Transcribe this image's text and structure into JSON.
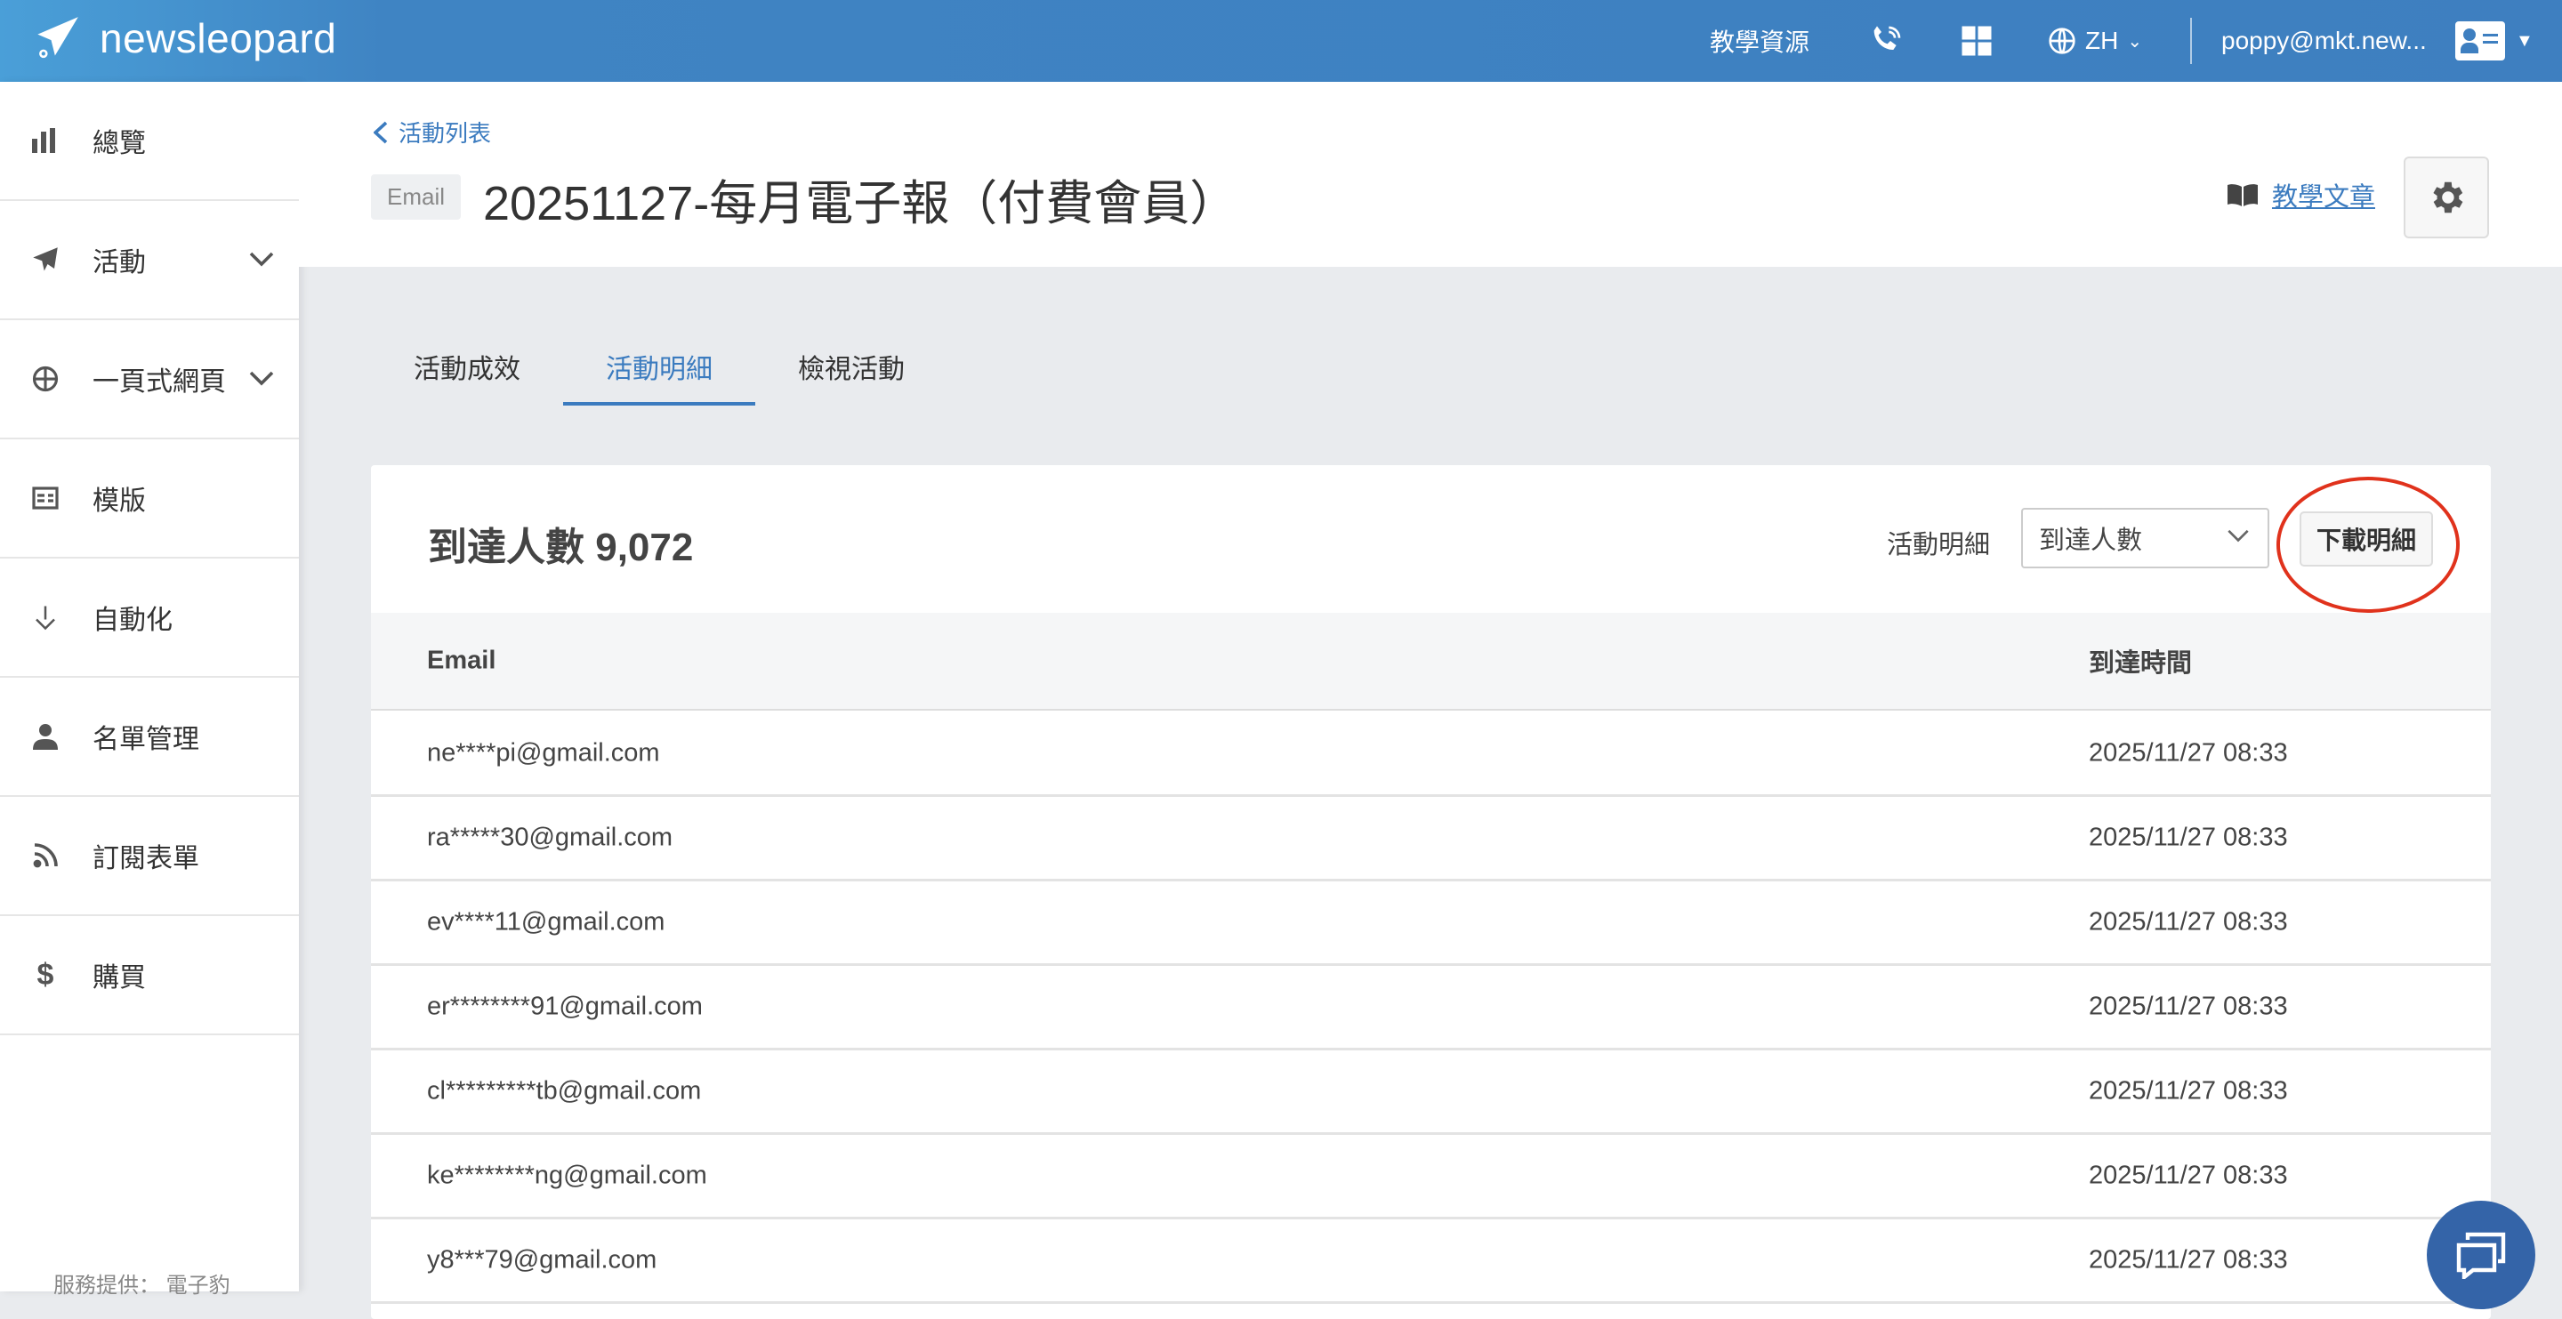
{
  "topbar": {
    "brand": "newsleopard",
    "resources": "教學資源",
    "language": "ZH",
    "account": "poppy@mkt.new..."
  },
  "sidebar": {
    "items": [
      {
        "label": "總覽",
        "icon": "bar-chart-icon"
      },
      {
        "label": "活動",
        "icon": "paper-plane-icon",
        "expandable": true
      },
      {
        "label": "一頁式網頁",
        "icon": "globe-icon",
        "expandable": true
      },
      {
        "label": "模版",
        "icon": "template-icon"
      },
      {
        "label": "自動化",
        "icon": "automation-icon"
      },
      {
        "label": "名單管理",
        "icon": "person-icon"
      },
      {
        "label": "訂閱表單",
        "icon": "rss-icon"
      },
      {
        "label": "購買",
        "icon": "dollar-icon"
      }
    ],
    "footer": "服務提供： 電子豹"
  },
  "page": {
    "back_label": "活動列表",
    "type_tag": "Email",
    "title": "20251127-每月電子報（付費會員）",
    "tutorial_link": "教學文章"
  },
  "tabs": [
    {
      "label": "活動成效",
      "active": false
    },
    {
      "label": "活動明細",
      "active": true
    },
    {
      "label": "檢視活動",
      "active": false
    }
  ],
  "detail": {
    "count_label": "到達人數 9,072",
    "filter_label": "活動明細",
    "filter_value": "到達人數",
    "download_label": "下載明細",
    "columns": [
      "Email",
      "到達時間"
    ],
    "rows": [
      [
        "ne****pi@gmail.com",
        "2025/11/27 08:33"
      ],
      [
        "ra*****30@gmail.com",
        "2025/11/27 08:33"
      ],
      [
        "ev****11@gmail.com",
        "2025/11/27 08:33"
      ],
      [
        "er********91@gmail.com",
        "2025/11/27 08:33"
      ],
      [
        "cl*********tb@gmail.com",
        "2025/11/27 08:33"
      ],
      [
        "ke********ng@gmail.com",
        "2025/11/27 08:33"
      ],
      [
        "y8***79@gmail.com",
        "2025/11/27 08:33"
      ]
    ]
  },
  "colors": {
    "brand": "#3e7fc0",
    "accent": "#3b7bbf",
    "highlight": "#e0321c"
  }
}
